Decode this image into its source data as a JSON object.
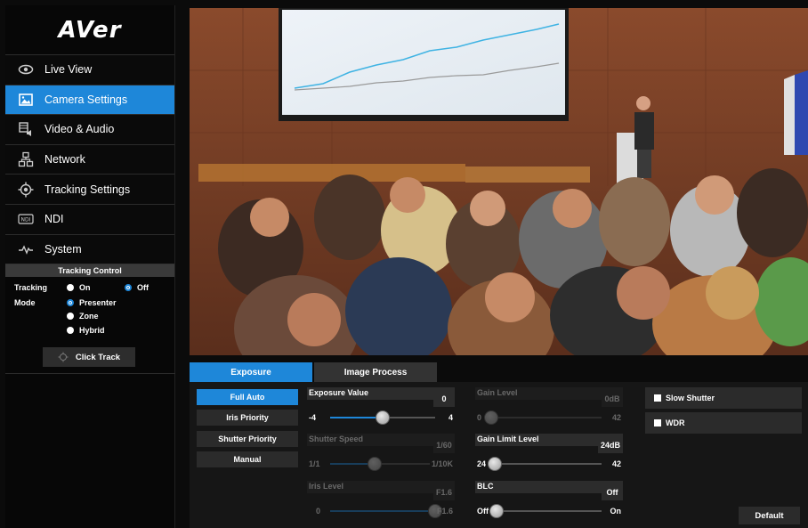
{
  "logo": "AVer",
  "nav": [
    {
      "label": "Live View",
      "icon": "eye-icon"
    },
    {
      "label": "Camera Settings",
      "icon": "image-icon"
    },
    {
      "label": "Video & Audio",
      "icon": "video-audio-icon"
    },
    {
      "label": "Network",
      "icon": "network-icon"
    },
    {
      "label": "Tracking Settings",
      "icon": "target-icon"
    },
    {
      "label": "NDI",
      "icon": "ndi-icon"
    },
    {
      "label": "System",
      "icon": "pulse-icon"
    }
  ],
  "active_nav": "Camera Settings",
  "tracking": {
    "header": "Tracking Control",
    "tracking_label": "Tracking",
    "on_label": "On",
    "off_label": "Off",
    "mode_label": "Mode",
    "modes": [
      "Presenter",
      "Zone",
      "Hybrid"
    ],
    "selected_mode": "Presenter",
    "selected_tracking": "Off",
    "click_track": "Click Track"
  },
  "tabs": [
    "Exposure",
    "Image Process"
  ],
  "active_tab": "Exposure",
  "modes": [
    "Full Auto",
    "Iris Priority",
    "Shutter Priority",
    "Manual"
  ],
  "active_mode": "Full Auto",
  "controls": {
    "exposure_value": {
      "label": "Exposure Value",
      "value": "0",
      "min": "-4",
      "max": "4",
      "position": 0.5,
      "enabled": true
    },
    "shutter_speed": {
      "label": "Shutter Speed",
      "value": "1/60",
      "min": "1/1",
      "max": "1/10K",
      "position": 0.45,
      "enabled": false
    },
    "iris_level": {
      "label": "Iris Level",
      "value": "F1.6",
      "min": "0",
      "max": "F1.6",
      "position": 1.0,
      "enabled": false
    },
    "gain_level": {
      "label": "Gain Level",
      "value": "0dB",
      "min": "0",
      "max": "42",
      "position": 0.0,
      "enabled": false
    },
    "gain_limit_level": {
      "label": "Gain Limit Level",
      "value": "24dB",
      "min": "24",
      "max": "42",
      "position": 0.0,
      "enabled": true
    },
    "blc": {
      "label": "BLC",
      "value": "Off",
      "min": "Off",
      "max": "On",
      "position": 0.0,
      "enabled": true
    }
  },
  "checkboxes": [
    "Slow Shutter",
    "WDR"
  ],
  "default_button": "Default",
  "colors": {
    "accent": "#1e87d9",
    "background": "#0b0b0b"
  }
}
